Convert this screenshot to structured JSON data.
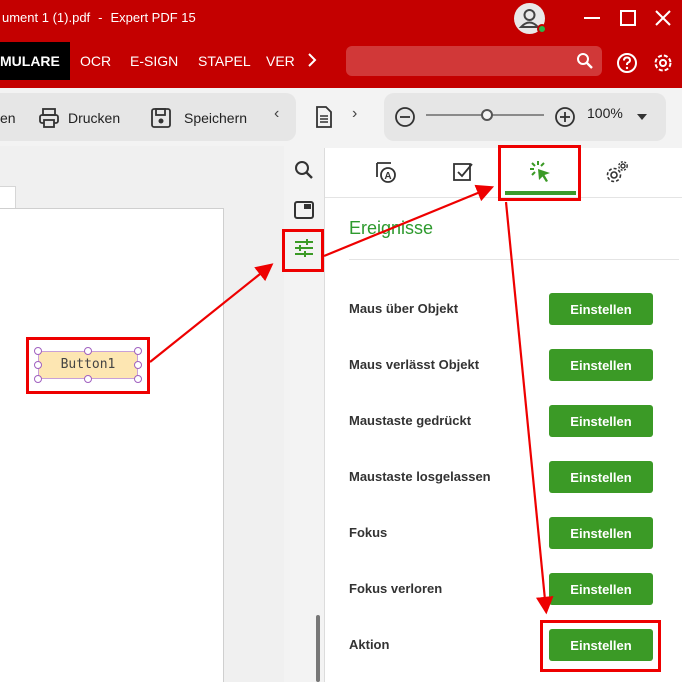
{
  "titlebar": {
    "doc_title": "ument 1 (1).pdf",
    "separator": "-",
    "app_name": "Expert PDF 15"
  },
  "ribbon": {
    "tabs": [
      {
        "label": "MULARE",
        "active": true
      },
      {
        "label": "OCR",
        "active": false
      },
      {
        "label": "E-SIGN",
        "active": false
      },
      {
        "label": "STAPEL",
        "active": false
      },
      {
        "label": "VER",
        "active": false
      }
    ]
  },
  "toolbar": {
    "cut_label": "en",
    "print_label": "Drucken",
    "save_label": "Speichern",
    "zoom": "100%"
  },
  "document": {
    "field_label": "Button1"
  },
  "panel": {
    "title": "Ereignisse",
    "button_label": "Einstellen",
    "events": [
      {
        "label": "Maus über Objekt"
      },
      {
        "label": "Maus verlässt Objekt"
      },
      {
        "label": "Maustaste gedrückt"
      },
      {
        "label": "Maustaste losgelassen"
      },
      {
        "label": "Fokus"
      },
      {
        "label": "Fokus verloren"
      },
      {
        "label": "Aktion"
      }
    ]
  },
  "colors": {
    "brand": "#c40000",
    "accent_green": "#3b9a26",
    "highlight": "#e00000"
  }
}
